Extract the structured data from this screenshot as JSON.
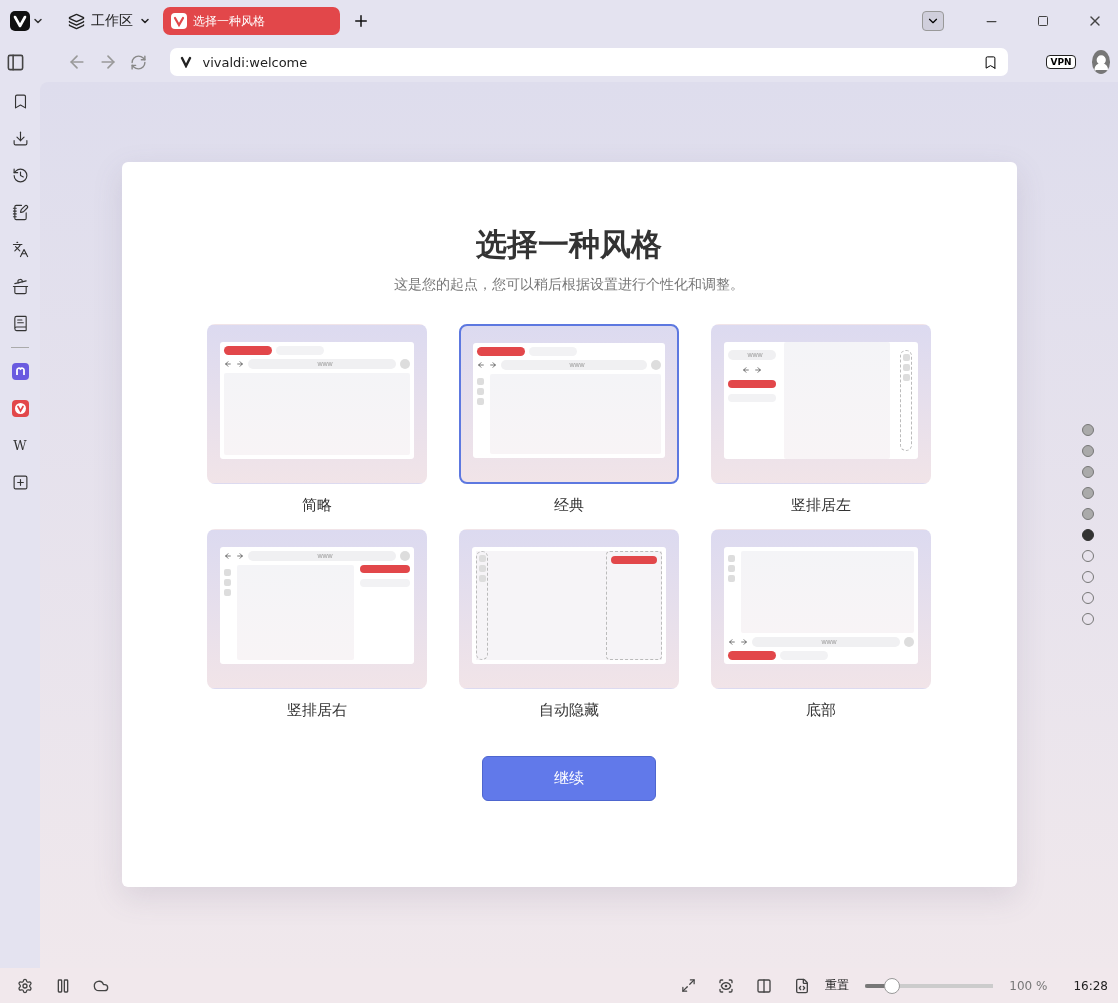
{
  "workspace": {
    "label": "工作区"
  },
  "tabs": [
    {
      "title": "选择一种风格",
      "selected": true
    }
  ],
  "address_bar": {
    "value": "vivaldi:welcome"
  },
  "vpn": {
    "label": "VPN"
  },
  "sidebar": {
    "panels": [
      {
        "kind": "bookmarks"
      },
      {
        "kind": "downloads"
      },
      {
        "kind": "history"
      },
      {
        "kind": "notes"
      },
      {
        "kind": "translate"
      },
      {
        "kind": "reading"
      },
      {
        "kind": "book"
      },
      {
        "kind": "divider"
      },
      {
        "kind": "mastodon"
      },
      {
        "kind": "vivaldi"
      },
      {
        "kind": "wiki",
        "label": "W"
      },
      {
        "kind": "add"
      }
    ]
  },
  "welcome": {
    "title": "选择一种风格",
    "subtitle": "这是您的起点，您可以稍后根据设置进行个性化和调整。",
    "styles": [
      {
        "label": "简略",
        "kind": "simple",
        "url_hint": "www",
        "selected": false
      },
      {
        "label": "经典",
        "kind": "classic",
        "url_hint": "www",
        "selected": true
      },
      {
        "label": "竖排居左",
        "kind": "left",
        "url_hint": "www",
        "selected": false
      },
      {
        "label": "竖排居右",
        "kind": "right",
        "url_hint": "www",
        "selected": false
      },
      {
        "label": "自动隐藏",
        "kind": "autohide",
        "selected": false
      },
      {
        "label": "底部",
        "kind": "bottom",
        "url_hint": "www",
        "selected": false
      }
    ],
    "continue_button": "继续"
  },
  "steps": [
    {
      "done": true,
      "selected": false
    },
    {
      "done": true,
      "selected": false
    },
    {
      "done": true,
      "selected": false
    },
    {
      "done": true,
      "selected": false
    },
    {
      "done": true,
      "selected": false
    },
    {
      "done": false,
      "selected": true
    },
    {
      "done": false,
      "selected": false
    },
    {
      "done": false,
      "selected": false
    },
    {
      "done": false,
      "selected": false
    },
    {
      "done": false,
      "selected": false
    }
  ],
  "status_bar": {
    "reset": "重置",
    "zoom": {
      "level": 0.2,
      "reading": "100 %"
    },
    "clock": "16:28"
  }
}
